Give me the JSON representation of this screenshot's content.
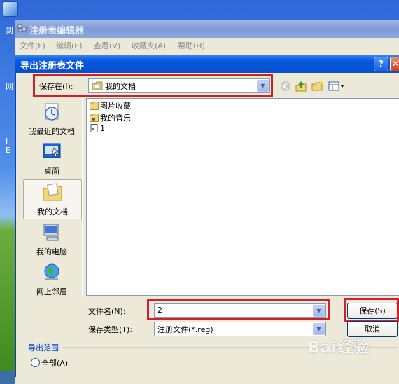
{
  "registry_window": {
    "title": "注册表编辑器",
    "menu": [
      "文件(F)",
      "编辑(E)",
      "查看(V)",
      "收藏夹(A)",
      "帮助(H)"
    ]
  },
  "desktop": {
    "icon_chars": [
      "到",
      "网",
      "I",
      "E"
    ]
  },
  "dialog": {
    "title": "导出注册表文件",
    "help_button": "?",
    "close_button": "✕",
    "save_in_label": "保存在(I):",
    "save_in_value": "我的文档",
    "toolbar_icons": [
      "back-icon",
      "up-folder-icon",
      "new-folder-icon",
      "view-menu-icon"
    ]
  },
  "places": [
    {
      "label": "我最近的文档",
      "icon": "recent-documents-icon"
    },
    {
      "label": "桌面",
      "icon": "desktop-icon"
    },
    {
      "label": "我的文档",
      "icon": "my-documents-icon",
      "selected": true
    },
    {
      "label": "我的电脑",
      "icon": "my-computer-icon"
    },
    {
      "label": "网上邻居",
      "icon": "network-places-icon"
    }
  ],
  "files": [
    {
      "name": "图片收藏",
      "icon": "folder-icon"
    },
    {
      "name": "我的音乐",
      "icon": "folder-icon"
    },
    {
      "name": "1",
      "icon": "reg-file-icon"
    }
  ],
  "filename": {
    "label": "文件名(N):",
    "value": "2"
  },
  "filetype": {
    "label": "保存类型(T):",
    "value": "注册文件(*.reg)"
  },
  "buttons": {
    "save": "保存(S)",
    "cancel": "取消"
  },
  "export_range": {
    "title": "导出范围",
    "all_option": "全部(A)"
  },
  "watermark": "Bai经验",
  "colors": {
    "highlight_box": "#d1202a",
    "title_bar": "#0753d8"
  }
}
